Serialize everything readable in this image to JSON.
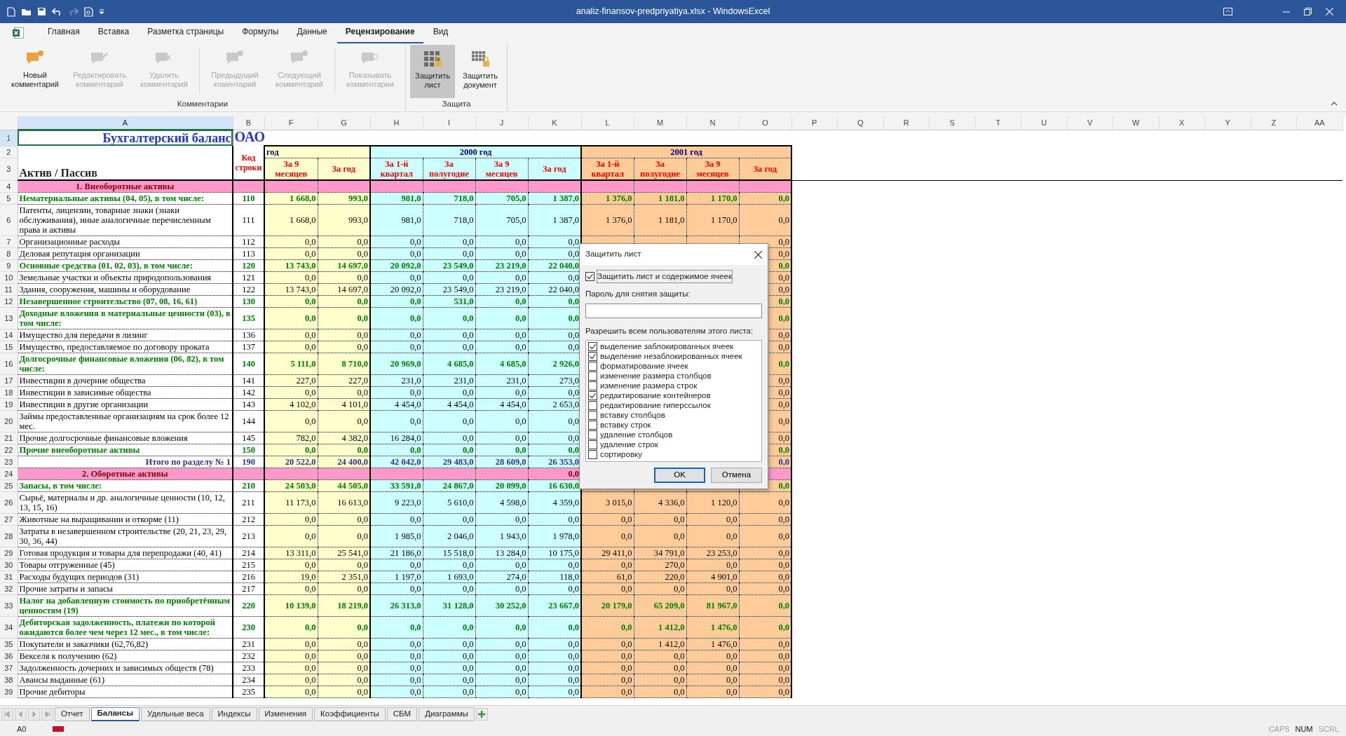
{
  "window": {
    "title": "analiz-finansov-predpriyatiya.xlsx - WindowsExcel"
  },
  "ribbon_tabs": [
    {
      "label": "Главная",
      "selected": false
    },
    {
      "label": "Вставка",
      "selected": false
    },
    {
      "label": "Разметка страницы",
      "selected": false
    },
    {
      "label": "Формулы",
      "selected": false
    },
    {
      "label": "Данные",
      "selected": false
    },
    {
      "label": "Рецензирование",
      "selected": true
    },
    {
      "label": "Вид",
      "selected": false
    }
  ],
  "ribbon_groups": [
    {
      "label": "Комментарии",
      "buttons": [
        {
          "label": "Новый\nкомментарий",
          "disabled": false,
          "pressed": false
        },
        {
          "label": "Редактировать\nкомментарий",
          "disabled": true,
          "pressed": false
        },
        {
          "label": "Удалить\nкомментарий",
          "disabled": true,
          "pressed": false
        },
        {
          "label": "Предыдущий\nкоментарий",
          "disabled": true,
          "pressed": false
        },
        {
          "label": "Следующий\nкомментарий",
          "disabled": true,
          "pressed": false
        },
        {
          "label": "Показывать\nкомментарии",
          "disabled": true,
          "pressed": false
        }
      ]
    },
    {
      "label": "Защита",
      "buttons": [
        {
          "label": "Защитить\nлист",
          "disabled": false,
          "pressed": true
        },
        {
          "label": "Защитить\nдокумент",
          "disabled": false,
          "pressed": false
        }
      ]
    }
  ],
  "sheet": {
    "columns": [
      {
        "letter": "A",
        "selected": true
      },
      {
        "letter": "B",
        "selected": false
      },
      {
        "letter": "F",
        "selected": false
      },
      {
        "letter": "G",
        "selected": false
      },
      {
        "letter": "H",
        "selected": false
      },
      {
        "letter": "I",
        "selected": false
      },
      {
        "letter": "J",
        "selected": false
      },
      {
        "letter": "K",
        "selected": false
      },
      {
        "letter": "L",
        "selected": false
      },
      {
        "letter": "M",
        "selected": false
      },
      {
        "letter": "N",
        "selected": false
      },
      {
        "letter": "O",
        "selected": false
      },
      {
        "letter": "P",
        "selected": false
      },
      {
        "letter": "Q",
        "selected": false
      },
      {
        "letter": "R",
        "selected": false
      },
      {
        "letter": "S",
        "selected": false
      },
      {
        "letter": "T",
        "selected": false
      },
      {
        "letter": "U",
        "selected": false
      },
      {
        "letter": "V",
        "selected": false
      },
      {
        "letter": "W",
        "selected": false
      },
      {
        "letter": "X",
        "selected": false
      },
      {
        "letter": "Y",
        "selected": false
      },
      {
        "letter": "Z",
        "selected": false
      },
      {
        "letter": "AA",
        "selected": false
      }
    ],
    "title_row": {
      "num": "1",
      "selected": true,
      "text": "Бухгалтерский  баланс",
      "text_b": "ОАО"
    },
    "header_rows": {
      "nums": [
        "2",
        "3"
      ],
      "label": "Актив / Пассив",
      "code_label": "Код строки",
      "periods": [
        {
          "year": "год",
          "subs": [
            "За  9 месяцев",
            "За  год"
          ]
        },
        {
          "year": "2000 год",
          "subs": [
            "За  1-й квартал",
            "За полугодие",
            "За  9 месяцев",
            "За  год"
          ]
        },
        {
          "year": "2001 год",
          "subs": [
            "За  1-й квартал",
            "За полугодие",
            "За  9 месяцев",
            "За  год"
          ]
        }
      ]
    },
    "rows": [
      {
        "num": "4",
        "kind": "section",
        "label": "1. Внеоборотные  активы",
        "cells": {}
      },
      {
        "num": "5",
        "kind": "group",
        "label": "Нематериальные  активы (04, 05), в том  числе:",
        "code": "110",
        "cells": {
          "col_f": "1 668,0",
          "col_g": "993,0",
          "col_h": "981,0",
          "col_i": "718,0",
          "col_j": "705,0",
          "col_k": "1 387,0",
          "col_l": "1 376,0",
          "col_m": "1 181,0",
          "col_n": "1 170,0",
          "col_o": "0,0"
        }
      },
      {
        "num": "6",
        "kind": "item",
        "label": "Патенты, лицензии,  товарные  знаки  (знаки обслуживания),  иные аналогичные  перечисленным  права и  активы",
        "code": "111",
        "cells": {
          "col_f": "1 668,0",
          "col_g": "993,0",
          "col_h": "981,0",
          "col_i": "718,0",
          "col_j": "705,0",
          "col_k": "1 387,0",
          "col_l": "1 376,0",
          "col_m": "1 181,0",
          "col_n": "1 170,0",
          "col_o": "0,0"
        }
      },
      {
        "num": "7",
        "kind": "item",
        "label": "Организационные  расходы",
        "code": "112",
        "cells": {
          "col_f": "0,0",
          "col_g": "0,0",
          "col_h": "0,0",
          "col_i": "0,0",
          "col_j": "0,0",
          "col_k": "0,0",
          "col_o": "0,0"
        }
      },
      {
        "num": "8",
        "kind": "item",
        "label": "Деловая репутация организации",
        "code": "113",
        "cells": {
          "col_f": "0,0",
          "col_g": "0,0",
          "col_h": "0,0",
          "col_i": "0,0",
          "col_j": "0,0",
          "col_k": "0,0",
          "col_o": "0,0"
        }
      },
      {
        "num": "9",
        "kind": "group",
        "label": "Основные  средства (01, 02, 03), в  том  числе:",
        "code": "120",
        "cells": {
          "col_f": "13 743,0",
          "col_g": "14 697,0",
          "col_h": "20 092,0",
          "col_i": "23 549,0",
          "col_j": "23 219,0",
          "col_k": "22 040,0",
          "col_o": "0,0"
        }
      },
      {
        "num": "10",
        "kind": "item",
        "label": "Земельные  участки  и  объекты  природопользования",
        "code": "121",
        "cells": {
          "col_f": "0,0",
          "col_g": "0,0",
          "col_h": "0,0",
          "col_i": "0,0",
          "col_j": "0,0",
          "col_k": "0,0",
          "col_o": "0,0"
        }
      },
      {
        "num": "11",
        "kind": "item",
        "label": "Здания,  сооружения,  машины  и  оборудование",
        "code": "122",
        "cells": {
          "col_f": "13 743,0",
          "col_g": "14 697,0",
          "col_h": "20 092,0",
          "col_i": "23 549,0",
          "col_j": "23 219,0",
          "col_k": "22 040,0",
          "col_o": "0,0"
        }
      },
      {
        "num": "12",
        "kind": "group",
        "label": "Незавершенное  строительство (07, 08, 16, 61)",
        "code": "130",
        "cells": {
          "col_f": "0,0",
          "col_g": "0,0",
          "col_h": "0,0",
          "col_i": "531,0",
          "col_j": "0,0",
          "col_k": "0,0",
          "col_o": "0,0"
        }
      },
      {
        "num": "13",
        "kind": "group",
        "label": "Доходные  вложения  в  материальные  ценности (03), в  том  числе:",
        "code": "135",
        "cells": {
          "col_f": "0,0",
          "col_g": "0,0",
          "col_h": "0,0",
          "col_i": "0,0",
          "col_j": "0,0",
          "col_k": "0,0",
          "col_o": "0,0"
        }
      },
      {
        "num": "14",
        "kind": "item",
        "label": "Имущество  для  передачи  в  лизинг",
        "code": "136",
        "cells": {
          "col_f": "0,0",
          "col_g": "0,0",
          "col_h": "0,0",
          "col_i": "0,0",
          "col_j": "0,0",
          "col_k": "0,0",
          "col_o": "0,0"
        }
      },
      {
        "num": "15",
        "kind": "item",
        "label": "Имущество,  предоставляемое  по  договору  проката",
        "code": "137",
        "cells": {
          "col_f": "0,0",
          "col_g": "0,0",
          "col_h": "0,0",
          "col_i": "0,0",
          "col_j": "0,0",
          "col_k": "0,0",
          "col_o": "0,0"
        }
      },
      {
        "num": "16",
        "kind": "group",
        "label": "Долгосрочные  финансовые  вложения (06, 82), в  том числе:",
        "code": "140",
        "cells": {
          "col_f": "5 111,0",
          "col_g": "8 710,0",
          "col_h": "20 969,0",
          "col_i": "4 685,0",
          "col_j": "4 685,0",
          "col_k": "2 926,0",
          "col_o": "0,0"
        }
      },
      {
        "num": "17",
        "kind": "item",
        "label": "Инвестиции  в  дочерние  общества",
        "code": "141",
        "cells": {
          "col_f": "227,0",
          "col_g": "227,0",
          "col_h": "231,0",
          "col_i": "231,0",
          "col_j": "231,0",
          "col_k": "273,0",
          "col_o": "0,0"
        }
      },
      {
        "num": "18",
        "kind": "item",
        "label": "Инвестиции  в  зависимые  общества",
        "code": "142",
        "cells": {
          "col_f": "0,0",
          "col_g": "0,0",
          "col_h": "0,0",
          "col_i": "0,0",
          "col_j": "0,0",
          "col_k": "0,0",
          "col_o": "0,0"
        }
      },
      {
        "num": "19",
        "kind": "item",
        "label": "Инвестиции  в  другие  организации",
        "code": "143",
        "cells": {
          "col_f": "4 102,0",
          "col_g": "4 101,0",
          "col_h": "4 454,0",
          "col_i": "4 454,0",
          "col_j": "4 454,0",
          "col_k": "2 653,0",
          "col_o": "0,0"
        }
      },
      {
        "num": "20",
        "kind": "item",
        "label": "Займы  предоставленные  организациям  на  срок  более  12 мес.",
        "code": "144",
        "cells": {
          "col_f": "0,0",
          "col_g": "0,0",
          "col_h": "0,0",
          "col_i": "0,0",
          "col_j": "0,0",
          "col_k": "0,0",
          "col_o": "0,0"
        }
      },
      {
        "num": "21",
        "kind": "item",
        "label": "Прочие  долгосрочные  финансовые  вложения",
        "code": "145",
        "cells": {
          "col_f": "782,0",
          "col_g": "4 382,0",
          "col_h": "16 284,0",
          "col_i": "0,0",
          "col_j": "0,0",
          "col_k": "0,0",
          "col_o": "0,0"
        }
      },
      {
        "num": "22",
        "kind": "group",
        "label": "Прочие  внеоборотные  активы",
        "code": "150",
        "cells": {
          "col_f": "0,0",
          "col_g": "0,0",
          "col_h": "0,0",
          "col_i": "0,0",
          "col_j": "0,0",
          "col_k": "0,0",
          "col_o": "0,0"
        }
      },
      {
        "num": "23",
        "kind": "total",
        "label": "Итого  по  разделу  № 1",
        "code": "190",
        "cells": {
          "col_f": "20 522,0",
          "col_g": "24 400,0",
          "col_h": "42 042,0",
          "col_i": "29 483,0",
          "col_j": "28 609,0",
          "col_k": "26 353,0",
          "col_o": "0,0"
        }
      },
      {
        "num": "24",
        "kind": "section",
        "label": "2. Оборотные  активы",
        "cells": {
          "col_k": "0,0"
        }
      },
      {
        "num": "25",
        "kind": "group",
        "label": "Запасы,  в  том  числе:",
        "code": "210",
        "cells": {
          "col_f": "24 503,0",
          "col_g": "44 505,0",
          "col_h": "33 591,0",
          "col_i": "24 867,0",
          "col_j": "20 099,0",
          "col_k": "16 630,0",
          "col_o": "0,0"
        }
      },
      {
        "num": "26",
        "kind": "item",
        "label": "Сырьё,  материалы  и  др. аналогичные  ценности (10, 12, 13,  15, 16)",
        "code": "211",
        "cells": {
          "col_f": "11 173,0",
          "col_g": "16 613,0",
          "col_h": "9 223,0",
          "col_i": "5 610,0",
          "col_j": "4 598,0",
          "col_k": "4 359,0",
          "col_l": "3 015,0",
          "col_m": "4 336,0",
          "col_n": "1 120,0",
          "col_o": "0,0"
        }
      },
      {
        "num": "27",
        "kind": "item",
        "label": "Животные  на  выращивании  и  откорме (11)",
        "code": "212",
        "cells": {
          "col_f": "0,0",
          "col_g": "0,0",
          "col_h": "0,0",
          "col_i": "0,0",
          "col_j": "0,0",
          "col_k": "0,0",
          "col_l": "0,0",
          "col_m": "0,0",
          "col_n": "0,0",
          "col_o": "0,0"
        }
      },
      {
        "num": "28",
        "kind": "item",
        "label": "Затраты  в  незавершенном  строительстве (20, 21, 23, 29, 30, 36, 44)",
        "code": "213",
        "cells": {
          "col_f": "0,0",
          "col_g": "0,0",
          "col_h": "1 985,0",
          "col_i": "2 046,0",
          "col_j": "1 943,0",
          "col_k": "1 978,0",
          "col_l": "0,0",
          "col_m": "0,0",
          "col_n": "0,0",
          "col_o": "0,0"
        }
      },
      {
        "num": "29",
        "kind": "item",
        "label": "Готовая  продукция  и  товары  для  перепродажи (40, 41)",
        "code": "214",
        "cells": {
          "col_f": "13 311,0",
          "col_g": "25 541,0",
          "col_h": "21 186,0",
          "col_i": "15 518,0",
          "col_j": "13 284,0",
          "col_k": "10 175,0",
          "col_l": "29 411,0",
          "col_m": "34 791,0",
          "col_n": "23 253,0",
          "col_o": "0,0"
        }
      },
      {
        "num": "30",
        "kind": "item",
        "label": "Товары  отгруженные  (45)",
        "code": "215",
        "cells": {
          "col_f": "0,0",
          "col_g": "0,0",
          "col_h": "0,0",
          "col_i": "0,0",
          "col_j": "0,0",
          "col_k": "0,0",
          "col_l": "0,0",
          "col_m": "270,0",
          "col_n": "0,0",
          "col_o": "0,0"
        }
      },
      {
        "num": "31",
        "kind": "item",
        "label": "Расходы  будущих  периодов (31)",
        "code": "216",
        "cells": {
          "col_f": "19,0",
          "col_g": "2 351,0",
          "col_h": "1 197,0",
          "col_i": "1 693,0",
          "col_j": "274,0",
          "col_k": "118,0",
          "col_l": "61,0",
          "col_m": "220,0",
          "col_n": "4 901,0",
          "col_o": "0,0"
        }
      },
      {
        "num": "32",
        "kind": "item",
        "label": "Прочие  затраты  и  запасы",
        "code": "217",
        "cells": {
          "col_f": "0,0",
          "col_g": "0,0",
          "col_h": "0,0",
          "col_i": "0,0",
          "col_j": "0,0",
          "col_k": "0,0",
          "col_l": "0,0",
          "col_m": "0,0",
          "col_n": "0,0",
          "col_o": "0,0"
        }
      },
      {
        "num": "33",
        "kind": "group",
        "label": "Налог  на  добавленную  стоимость  по приобретённым  ценностям (19)",
        "code": "220",
        "cells": {
          "col_f": "10 139,0",
          "col_g": "18 219,0",
          "col_h": "26 313,0",
          "col_i": "31 128,0",
          "col_j": "30 252,0",
          "col_k": "23 667,0",
          "col_l": "20 179,0",
          "col_m": "65 209,0",
          "col_n": "81 967,0",
          "col_o": "0,0"
        }
      },
      {
        "num": "34",
        "kind": "group",
        "label": "Дебиторская  задолженность,  платежи  по  которой ожидаются  более  чем  через  12  мес.,  в  том  числе:",
        "code": "230",
        "cells": {
          "col_f": "0,0",
          "col_g": "0,0",
          "col_h": "0,0",
          "col_i": "0,0",
          "col_j": "0,0",
          "col_k": "0,0",
          "col_l": "0,0",
          "col_m": "1 412,0",
          "col_n": "1 476,0",
          "col_o": "0,0"
        }
      },
      {
        "num": "35",
        "kind": "item",
        "label": "Покупатели  и  заказчики (62,76,82)",
        "code": "231",
        "cells": {
          "col_f": "0,0",
          "col_g": "0,0",
          "col_h": "0,0",
          "col_i": "0,0",
          "col_j": "0,0",
          "col_k": "0,0",
          "col_l": "0,0",
          "col_m": "1 412,0",
          "col_n": "1 476,0",
          "col_o": "0,0"
        }
      },
      {
        "num": "36",
        "kind": "item",
        "label": "Векселя  к  получению (62)",
        "code": "232",
        "cells": {
          "col_f": "0,0",
          "col_g": "0,0",
          "col_h": "0,0",
          "col_i": "0,0",
          "col_j": "0,0",
          "col_k": "0,0",
          "col_l": "0,0",
          "col_m": "0,0",
          "col_n": "0,0",
          "col_o": "0,0"
        }
      },
      {
        "num": "37",
        "kind": "item",
        "label": "Задолженность  дочерних и  зависимых  обществ (78)",
        "code": "233",
        "cells": {
          "col_f": "0,0",
          "col_g": "0,0",
          "col_h": "0,0",
          "col_i": "0,0",
          "col_j": "0,0",
          "col_k": "0,0",
          "col_l": "0,0",
          "col_m": "0,0",
          "col_n": "0,0",
          "col_o": "0,0"
        }
      },
      {
        "num": "38",
        "kind": "item",
        "label": "Авансы  выданные (61)",
        "code": "234",
        "cells": {
          "col_f": "0,0",
          "col_g": "0,0",
          "col_h": "0,0",
          "col_i": "0,0",
          "col_j": "0,0",
          "col_k": "0,0",
          "col_l": "0,0",
          "col_m": "0,0",
          "col_n": "0,0",
          "col_o": "0,0"
        }
      },
      {
        "num": "39",
        "kind": "item",
        "label": "Прочие  дебиторы",
        "code": "235",
        "cells": {
          "col_f": "0,0",
          "col_g": "0,0",
          "col_h": "0,0",
          "col_i": "0,0",
          "col_j": "0,0",
          "col_k": "0,0",
          "col_l": "0,0",
          "col_m": "0,0",
          "col_n": "0,0",
          "col_o": "0,0"
        }
      }
    ]
  },
  "dialog": {
    "title": "Защитить лист",
    "protect": {
      "label": "Защитить лист и содержимое ячеек",
      "checked": true
    },
    "password_label": "Пароль для снятия защиты:",
    "allow_label": "Разрешить всем пользователям этого листа:",
    "permissions": [
      {
        "label": "выделение заблокированных ячеек",
        "checked": true
      },
      {
        "label": "выделение незаблокированных ячеек",
        "checked": true
      },
      {
        "label": "форматирование ячеек",
        "checked": false
      },
      {
        "label": "изменение размера столбцов",
        "checked": false
      },
      {
        "label": "изменение размера строк",
        "checked": false
      },
      {
        "label": "редактирование контейнеров",
        "checked": true
      },
      {
        "label": "редактирование гиперссылок",
        "checked": false
      },
      {
        "label": "вставку столбцов",
        "checked": false
      },
      {
        "label": "вставку строк",
        "checked": false
      },
      {
        "label": "удаление столбцов",
        "checked": false
      },
      {
        "label": "удаление строк",
        "checked": false
      },
      {
        "label": "сортировку",
        "checked": false
      }
    ],
    "buttons": [
      {
        "label": "OK",
        "default": true
      },
      {
        "label": "Отмена",
        "default": false
      }
    ]
  },
  "sheet_tabs": [
    {
      "label": "Отчет",
      "selected": false
    },
    {
      "label": "Балансы",
      "selected": true
    },
    {
      "label": "Удельные веса",
      "selected": false
    },
    {
      "label": "Индексы",
      "selected": false
    },
    {
      "label": "Изменения",
      "selected": false
    },
    {
      "label": "Коэффициенты",
      "selected": false
    },
    {
      "label": "СБМ",
      "selected": false
    },
    {
      "label": "Диаграммы",
      "selected": false
    }
  ],
  "status_bar": {
    "cell": "A0",
    "indicators": [
      {
        "label": "CAPS",
        "on": false
      },
      {
        "label": "NUM",
        "on": true
      },
      {
        "label": "SCRL",
        "on": false
      }
    ]
  }
}
